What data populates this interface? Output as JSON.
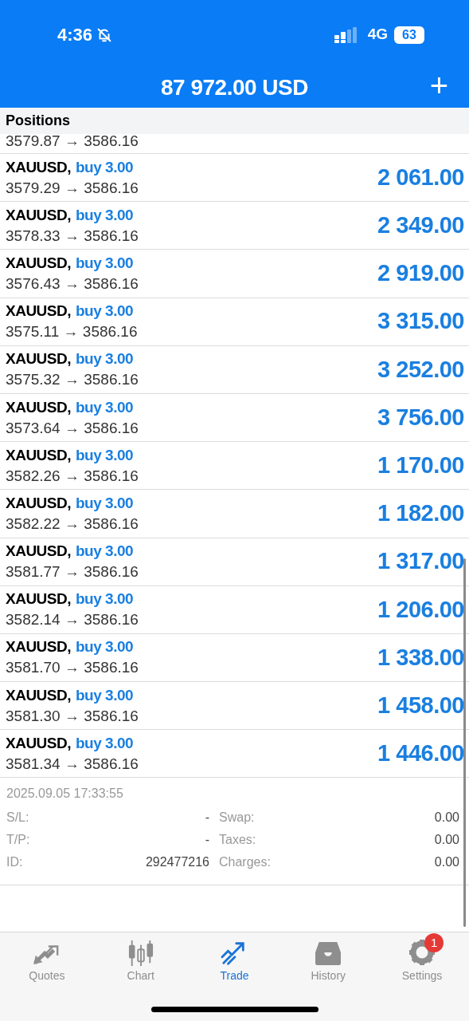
{
  "status_bar": {
    "time": "4:36",
    "network": "4G",
    "battery": "63"
  },
  "header": {
    "title": "87 972.00 USD",
    "add_icon": "+"
  },
  "section": {
    "title": "Positions"
  },
  "partial_row": {
    "prices": "3579.87 → 3586.16"
  },
  "positions": [
    {
      "symbol": "XAUUSD,",
      "side": "buy 3.00",
      "prices": "3579.29 → 3586.16",
      "profit": "2 061.00"
    },
    {
      "symbol": "XAUUSD,",
      "side": "buy 3.00",
      "prices": "3578.33 → 3586.16",
      "profit": "2 349.00"
    },
    {
      "symbol": "XAUUSD,",
      "side": "buy 3.00",
      "prices": "3576.43 → 3586.16",
      "profit": "2 919.00"
    },
    {
      "symbol": "XAUUSD,",
      "side": "buy 3.00",
      "prices": "3575.11 → 3586.16",
      "profit": "3 315.00"
    },
    {
      "symbol": "XAUUSD,",
      "side": "buy 3.00",
      "prices": "3575.32 → 3586.16",
      "profit": "3 252.00"
    },
    {
      "symbol": "XAUUSD,",
      "side": "buy 3.00",
      "prices": "3573.64 → 3586.16",
      "profit": "3 756.00"
    },
    {
      "symbol": "XAUUSD,",
      "side": "buy 3.00",
      "prices": "3582.26 → 3586.16",
      "profit": "1 170.00"
    },
    {
      "symbol": "XAUUSD,",
      "side": "buy 3.00",
      "prices": "3582.22 → 3586.16",
      "profit": "1 182.00"
    },
    {
      "symbol": "XAUUSD,",
      "side": "buy 3.00",
      "prices": "3581.77 → 3586.16",
      "profit": "1 317.00"
    },
    {
      "symbol": "XAUUSD,",
      "side": "buy 3.00",
      "prices": "3582.14 → 3586.16",
      "profit": "1 206.00"
    },
    {
      "symbol": "XAUUSD,",
      "side": "buy 3.00",
      "prices": "3581.70 → 3586.16",
      "profit": "1 338.00"
    },
    {
      "symbol": "XAUUSD,",
      "side": "buy 3.00",
      "prices": "3581.30 → 3586.16",
      "profit": "1 458.00"
    },
    {
      "symbol": "XAUUSD,",
      "side": "buy 3.00",
      "prices": "3581.34 → 3586.16",
      "profit": "1 446.00"
    }
  ],
  "details": {
    "time": "2025.09.05 17:33:55",
    "fields": [
      {
        "label": "S/L:",
        "value": "-",
        "label2": "Swap:",
        "value2": "0.00"
      },
      {
        "label": "T/P:",
        "value": "-",
        "label2": "Taxes:",
        "value2": "0.00"
      },
      {
        "label": "ID:",
        "value": "292477216",
        "label2": "Charges:",
        "value2": "0.00"
      }
    ]
  },
  "tab_bar": [
    {
      "kind": "quotes",
      "label": "Quotes",
      "selected": false
    },
    {
      "kind": "chart",
      "label": "Chart",
      "selected": false
    },
    {
      "kind": "trade",
      "label": "Trade",
      "selected": true
    },
    {
      "kind": "history",
      "label": "History",
      "selected": false
    },
    {
      "kind": "settings",
      "label": "Settings",
      "selected": false,
      "badge": "1"
    }
  ]
}
